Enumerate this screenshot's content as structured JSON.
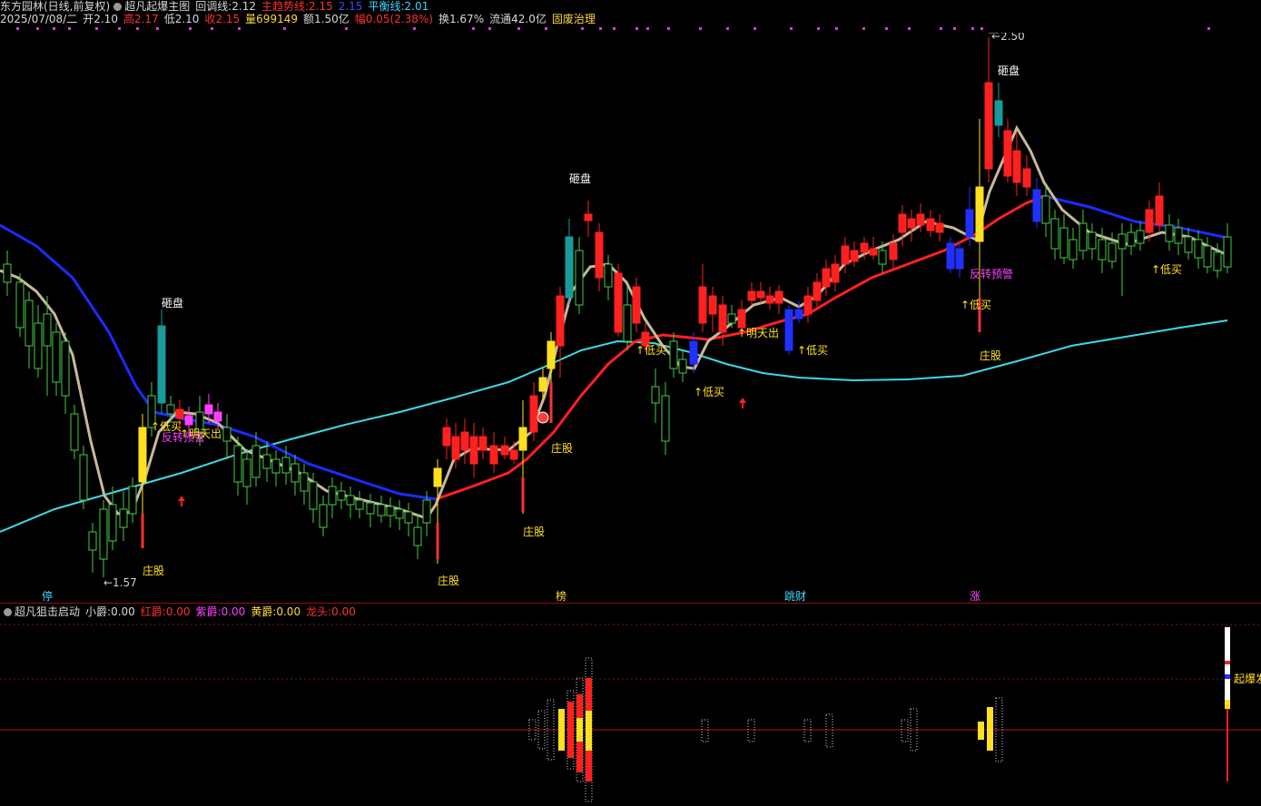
{
  "header": {
    "title": "东方园林(日线,前复权)",
    "indicator_name": "超凡起爆主图",
    "retrace_label": "回调线:",
    "retrace_value": "2.12",
    "trend_label": "主趋势线:",
    "trend_value": "2.15",
    "blue_value": "2.15",
    "balance_label": "平衡线:",
    "balance_value": "2.01"
  },
  "quote": {
    "date": "2025/07/08/二",
    "open_label": "开",
    "open": "2.10",
    "high_label": "高",
    "high": "2.17",
    "low_label": "低",
    "low": "2.10",
    "close_label": "收",
    "close": "2.15",
    "volume_label": "量",
    "volume": "699149",
    "amount_label": "额",
    "amount": "1.50亿",
    "change_label": "幅",
    "change": "0.05(2.38%)",
    "turnover_label": "换",
    "turnover": "1.67%",
    "float_label": "流通",
    "float": "42.0亿",
    "sector": "固废治理"
  },
  "indicator_panel": {
    "name": "超凡狙击启动",
    "items": [
      {
        "label": "小爵:",
        "value": "0.00",
        "color": "#d8d8d8"
      },
      {
        "label": "红爵:",
        "value": "0.00",
        "color": "#ff3030"
      },
      {
        "label": "紫爵:",
        "value": "0.00",
        "color": "#ff40ff"
      },
      {
        "label": "黄爵:",
        "value": "0.00",
        "color": "#ffd83a"
      },
      {
        "label": "龙头:",
        "value": "0.00",
        "color": "#ff3030"
      }
    ],
    "signal_label": "起爆发"
  },
  "bottom_tags": [
    {
      "label": "停",
      "color": "#3fd8ff"
    },
    {
      "label": "榜",
      "color": "#ffd83a"
    },
    {
      "label": "跳财",
      "color": "#3fd8ff"
    },
    {
      "label": "涨",
      "color": "#ff40ff"
    }
  ],
  "annotations": {
    "smash": "砸盘",
    "low_buy": "↑低买",
    "reversal": "反转预警",
    "sell_tomorrow": "↑明天出",
    "dealer": "庄股",
    "high_price": "2.50",
    "low_price": "1.57"
  },
  "colors": {
    "up": "#ff2020",
    "down": "#44cc44",
    "trend_red": "#ff2020",
    "trend_blue": "#1a2cff",
    "balance": "#3fd8e8",
    "retrace": "#c8b89a",
    "yellow": "#ffe020",
    "teal": "#1a9a9a",
    "magenta": "#ff40ff"
  }
}
